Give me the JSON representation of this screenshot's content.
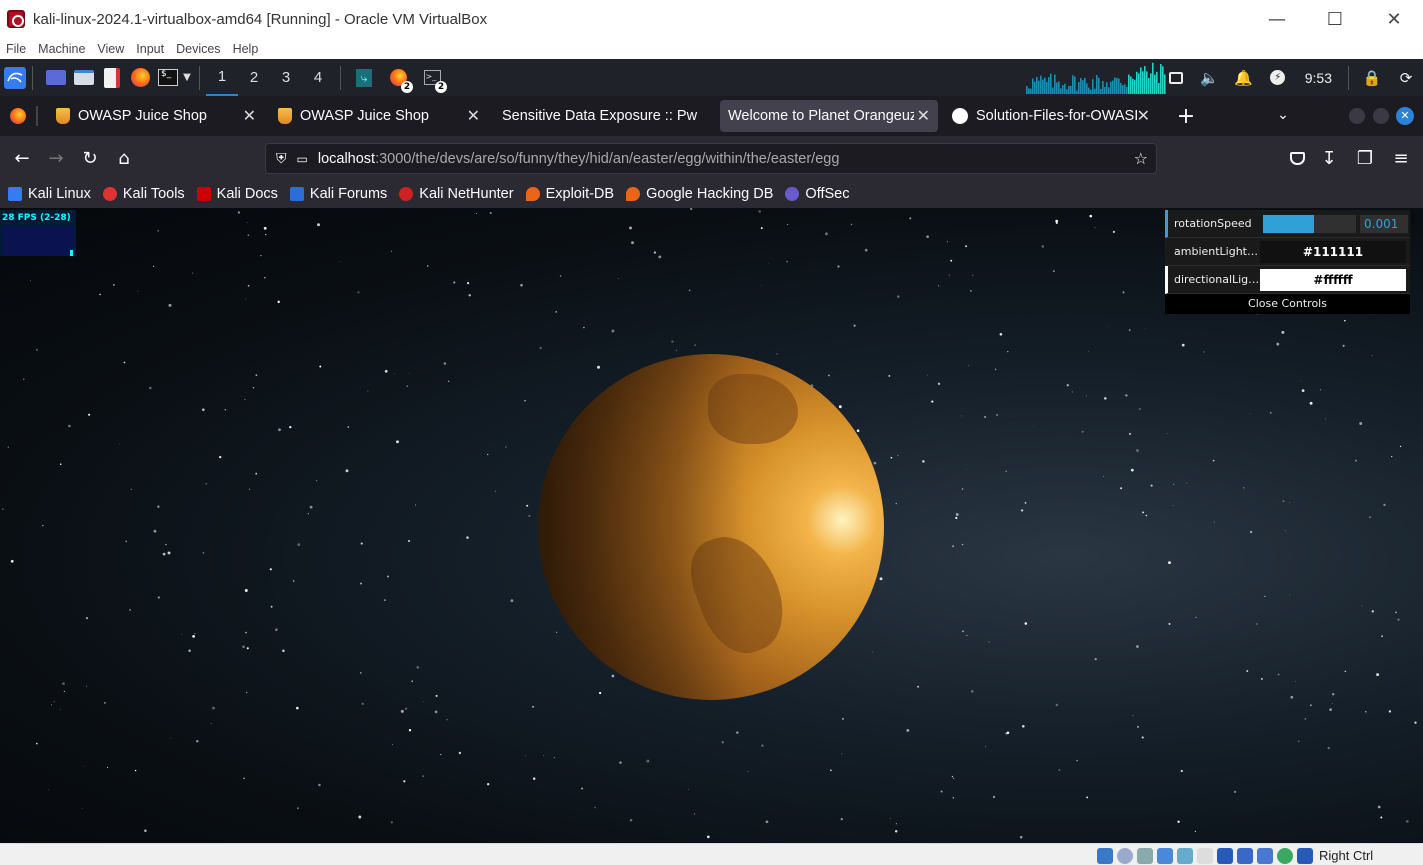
{
  "window": {
    "title": "kali-linux-2024.1-virtualbox-amd64 [Running] - Oracle VM VirtualBox",
    "menu": [
      "File",
      "Machine",
      "View",
      "Input",
      "Devices",
      "Help"
    ]
  },
  "panel": {
    "workspaces": [
      "1",
      "2",
      "3",
      "4"
    ],
    "active_workspace": "1",
    "firefox_badge": "2",
    "terminal_badge": "2",
    "clock": "9:53"
  },
  "browser": {
    "tabs": [
      {
        "label": "OWASP Juice Shop",
        "icon": "juice-shop-icon",
        "active": false
      },
      {
        "label": "OWASP Juice Shop",
        "icon": "juice-shop-icon",
        "active": false
      },
      {
        "label": "Sensitive Data Exposure :: Pw",
        "icon": "",
        "active": false
      },
      {
        "label": "Welcome to Planet Orangeuz",
        "icon": "",
        "active": true
      },
      {
        "label": "Solution-Files-for-OWASI",
        "icon": "github-icon",
        "active": false
      }
    ],
    "url_host": "localhost",
    "url_rest": ":3000/the/devs/are/so/funny/they/hid/an/easter/egg/within/the/easter/egg",
    "bookmarks": [
      {
        "label": "Kali Linux",
        "color": "#367bf0"
      },
      {
        "label": "Kali Tools",
        "color": "#d33"
      },
      {
        "label": "Kali Docs",
        "color": "#c00"
      },
      {
        "label": "Kali Forums",
        "color": "#2b6fd6"
      },
      {
        "label": "Kali NetHunter",
        "color": "#c22"
      },
      {
        "label": "Exploit-DB",
        "color": "#e8651a"
      },
      {
        "label": "Google Hacking DB",
        "color": "#e8651a"
      },
      {
        "label": "OffSec",
        "color": "#6a5acd"
      }
    ]
  },
  "scene": {
    "fps_text": "28 FPS (2-28)",
    "controls": {
      "rotation_label": "rotationSpeed",
      "rotation_value": "0.001",
      "rotation_fill": 0.55,
      "ambient_label": "ambientLightC...",
      "ambient_value": "#111111",
      "directional_label": "directionalLigh...",
      "directional_value": "#ffffff",
      "close_label": "Close Controls"
    }
  },
  "statusbar": {
    "host_key": "Right Ctrl"
  },
  "colors": {
    "accent": "#2fa1d6",
    "panel_bg": "#1f2229",
    "tab_bg": "#1c1b22"
  }
}
